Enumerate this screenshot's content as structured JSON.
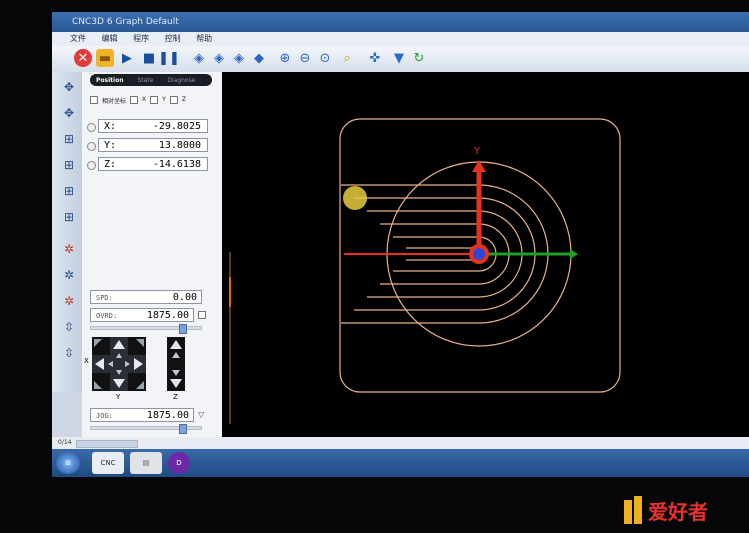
{
  "window": {
    "title": "CNC3D 6 Graph Default"
  },
  "menu": {
    "items": [
      "文件",
      "编辑",
      "程序",
      "控制",
      "帮助"
    ]
  },
  "toolbar": {
    "buttons": [
      "stop-icon",
      "open-folder-icon",
      "play-icon",
      "stop-square-icon",
      "pause-icon",
      "view-top-icon",
      "view-front-icon",
      "view-side-icon",
      "view-iso-icon",
      "zoom-in-icon",
      "zoom-out-icon",
      "zoom-fit-icon",
      "zoom-window-icon",
      "probe-icon",
      "tool-icon",
      "reset-icon"
    ]
  },
  "panel": {
    "tabs": [
      "Position",
      "State",
      "Diagnose"
    ],
    "active_tab": "Position",
    "checks": [
      "相对坐标",
      "X",
      "Y",
      "Z"
    ],
    "coords": [
      {
        "label": "X:",
        "value": "-29.8025"
      },
      {
        "label": "Y:",
        "value": "13.8000"
      },
      {
        "label": "Z:",
        "value": "-14.6138"
      }
    ],
    "spd": {
      "label": "SPD:",
      "value": "0.00"
    },
    "ovrd": {
      "label": "OVRD:",
      "value": "1875.00"
    },
    "jog": {
      "label": "JOG:",
      "value": "1875.00"
    },
    "jog_labels": {
      "xy_side": "X",
      "xy_bottom": "Y",
      "z_bottom": "Z"
    }
  },
  "canvas": {
    "axis_y_label": "Y"
  },
  "status": {
    "left": "0/14"
  },
  "taskbar": {
    "apps": [
      "start-orb",
      "cnc3d-app",
      "explorer",
      "media-app"
    ]
  },
  "watermark": {
    "text": "爱好者"
  },
  "colors": {
    "toolpath": "#e8b08a",
    "axis_x": "#e8321d",
    "axis_y": "#1fa02b",
    "tool": "#2b46d8"
  }
}
